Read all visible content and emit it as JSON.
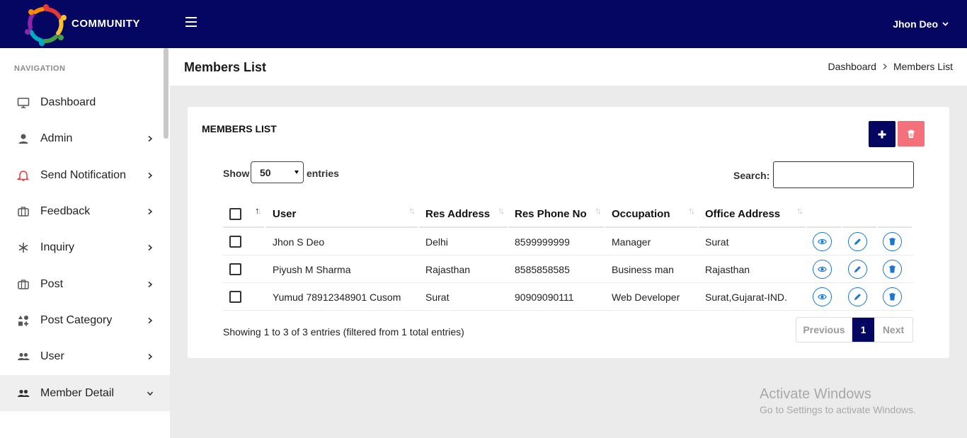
{
  "header": {
    "brand": "COMMUNITY",
    "user": "Jhon Deo"
  },
  "sidebar": {
    "heading": "NAVIGATION",
    "items": [
      {
        "label": "Dashboard",
        "icon": "monitor-icon",
        "has_children": false
      },
      {
        "label": "Admin",
        "icon": "person-icon",
        "has_children": true
      },
      {
        "label": "Send Notification",
        "icon": "bell-icon",
        "has_children": true,
        "icon_color": "#e53935"
      },
      {
        "label": "Feedback",
        "icon": "briefcase-icon",
        "has_children": true
      },
      {
        "label": "Inquiry",
        "icon": "asterisk-icon",
        "has_children": true
      },
      {
        "label": "Post",
        "icon": "briefcase-icon",
        "has_children": true
      },
      {
        "label": "Post Category",
        "icon": "category-icon",
        "has_children": true
      },
      {
        "label": "User",
        "icon": "people-icon",
        "has_children": true
      },
      {
        "label": "Member Detail",
        "icon": "people-icon",
        "has_children": true,
        "expanded": true,
        "active": true
      }
    ]
  },
  "page": {
    "title": "Members List",
    "breadcrumb": [
      "Dashboard",
      "Members List"
    ]
  },
  "card": {
    "title": "MEMBERS LIST",
    "show_label": "Show",
    "entries_label": "entries",
    "page_length": "50",
    "search_label": "Search:",
    "search_value": ""
  },
  "table": {
    "columns": [
      "User",
      "Res Address",
      "Res Phone No",
      "Occupation",
      "Office Address"
    ],
    "rows": [
      [
        "Jhon S Deo",
        "Delhi",
        "8599999999",
        "Manager",
        "Surat"
      ],
      [
        "Piyush M Sharma",
        "Rajasthan",
        "8585858585",
        "Business man",
        "Rajasthan"
      ],
      [
        "Yumud 78912348901 Cusom",
        "Surat",
        "90909090111",
        "Web Developer",
        "Surat,Gujarat-IND."
      ]
    ],
    "info": "Showing 1 to 3 of 3 entries (filtered from 1 total entries)"
  },
  "pagination": {
    "previous": "Previous",
    "current": "1",
    "next": "Next"
  },
  "watermark": {
    "line1": "Activate Windows",
    "line2": "Go to Settings to activate Windows."
  },
  "colors": {
    "primary": "#050562",
    "danger": "#f4707a",
    "action": "#1976d2"
  }
}
